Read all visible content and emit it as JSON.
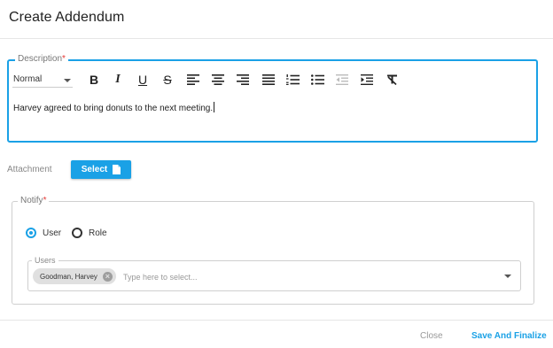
{
  "dialog": {
    "title": "Create Addendum"
  },
  "description": {
    "label": "Description",
    "required_mark": "*",
    "format_select": "Normal",
    "text": "Harvey agreed to bring donuts to the next meeting.",
    "toolbar": {
      "bold": "B",
      "italic": "I",
      "underline": "U",
      "strike": "S"
    }
  },
  "attachment": {
    "label": "Attachment",
    "button_label": "Select"
  },
  "notify": {
    "label": "Notify",
    "required_mark": "*",
    "options": [
      {
        "label": "User",
        "selected": true
      },
      {
        "label": "Role",
        "selected": false
      }
    ],
    "users": {
      "label": "Users",
      "chips": [
        "Goodman, Harvey"
      ],
      "placeholder": "Type here to select..."
    }
  },
  "footer": {
    "close_label": "Close",
    "save_label": "Save And Finalize"
  },
  "colors": {
    "accent": "#1aa1e6",
    "required": "#e53935"
  }
}
